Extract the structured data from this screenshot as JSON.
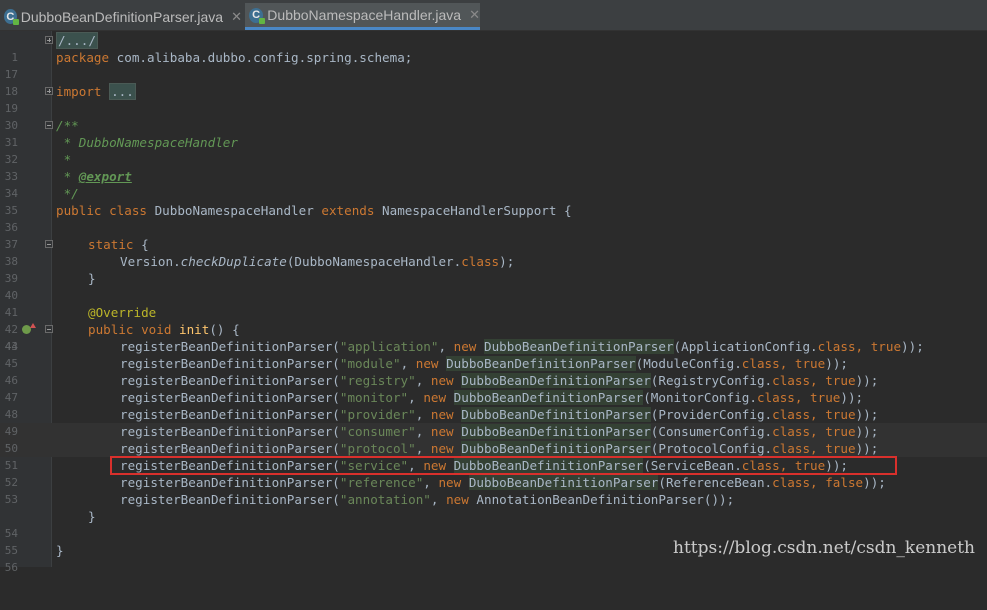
{
  "tabs": [
    {
      "label": "DubboBeanDefinitionParser.java",
      "icon": "java-class-icon",
      "active": false
    },
    {
      "label": "DubboNamespaceHandler.java",
      "icon": "java-class-icon",
      "active": true
    }
  ],
  "line_numbers": [
    "1",
    "17",
    "18",
    "19",
    "30",
    "31",
    "32",
    "33",
    "34",
    "35",
    "36",
    "37",
    "38",
    "39",
    "40",
    "41",
    "42",
    "43",
    "44",
    "45",
    "46",
    "47",
    "48",
    "49",
    "50",
    "51",
    "52",
    "53",
    "54",
    "55",
    "56"
  ],
  "code": {
    "l1": "/.../",
    "l17_kw": "package",
    "l17_pkg": " com.alibaba.dubbo.config.spring.schema;",
    "l19_kw": "import",
    "l19_fold": "...",
    "l31": "/**",
    "l32": " * DubboNamespaceHandler",
    "l33": " *",
    "l34_a": " * ",
    "l34_tag": "@export",
    "l35": " */",
    "l36_kw1": "public class",
    "l36_name": " DubboNamespaceHandler ",
    "l36_kw2": "extends",
    "l36_rest": " NamespaceHandlerSupport {",
    "l38_kw": "static",
    "l38_rest": " {",
    "l39_a": "Version.",
    "l39_m": "checkDuplicate",
    "l39_b": "(DubboNamespaceHandler.",
    "l39_kw": "class",
    "l39_c": ");",
    "l40": "}",
    "l42": "@Override",
    "l43_kw": "public void",
    "l43_m": " init",
    "l43_rest": "() {",
    "call": "registerBeanDefinitionParser(",
    "new_kw": "new",
    "parser": "DubboBeanDefinitionParser",
    "annot_parser": "AnnotationBeanDefinitionParser",
    "class_kw": "class",
    "close": "}",
    "final": "}"
  },
  "registrations": [
    {
      "name": "\"application\"",
      "config": "ApplicationConfig",
      "flag": "true",
      "hl": true
    },
    {
      "name": "\"module\"",
      "config": "ModuleConfig",
      "flag": "true",
      "hl": true
    },
    {
      "name": "\"registry\"",
      "config": "RegistryConfig",
      "flag": "true",
      "hl": true
    },
    {
      "name": "\"monitor\"",
      "config": "MonitorConfig",
      "flag": "true",
      "hl": true
    },
    {
      "name": "\"provider\"",
      "config": "ProviderConfig",
      "flag": "true",
      "hl": true
    },
    {
      "name": "\"consumer\"",
      "config": "ConsumerConfig",
      "flag": "true",
      "hl": true
    },
    {
      "name": "\"protocol\"",
      "config": "ProtocolConfig",
      "flag": "true",
      "hl": true
    },
    {
      "name": "\"service\"",
      "config": "ServiceBean",
      "flag": "true",
      "hl": true
    },
    {
      "name": "\"reference\"",
      "config": "ReferenceBean",
      "flag": "false",
      "hl": true
    },
    {
      "name": "\"annotation\"",
      "config": "",
      "flag": "",
      "hl": false
    }
  ],
  "watermark": "https://blog.csdn.net/csdn_kenneth",
  "colors": {
    "background": "#2b2b2b",
    "keyword": "#cc7832",
    "string": "#6a8759",
    "comment": "#629755",
    "highlight_box": "#d9302c"
  }
}
